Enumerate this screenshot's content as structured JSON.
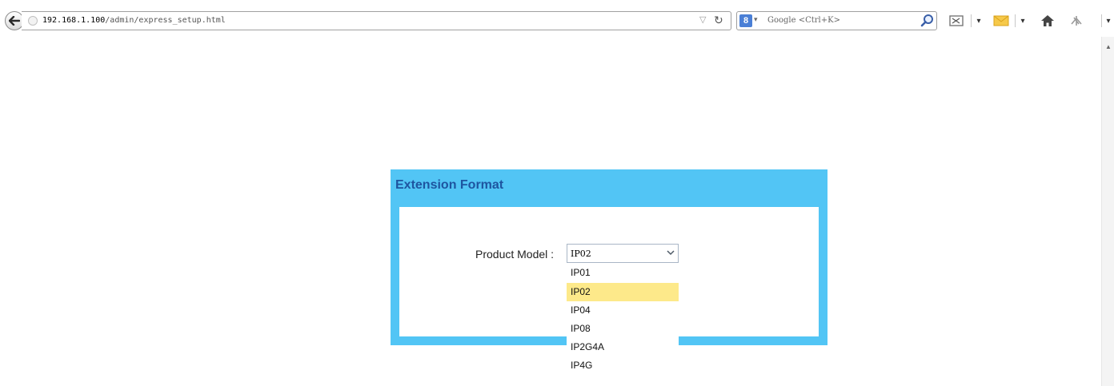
{
  "browser": {
    "url_host": "192.168.1.100",
    "url_path": "/admin/express_setup.html",
    "search_engine_badge": "8",
    "search_placeholder": "Google <Ctrl+K>"
  },
  "page": {
    "panel_title": "Extension Format",
    "product_model_label": "Product Model :",
    "product_model_value": "IP02",
    "options": [
      "IP01",
      "IP02",
      "IP04",
      "IP08",
      "IP2G4A",
      "IP4G"
    ],
    "highlighted_option": "IP02"
  },
  "colors": {
    "panel_blue": "#52c5f5",
    "title_blue": "#1e55a0",
    "highlight_yellow": "#fde98a"
  }
}
